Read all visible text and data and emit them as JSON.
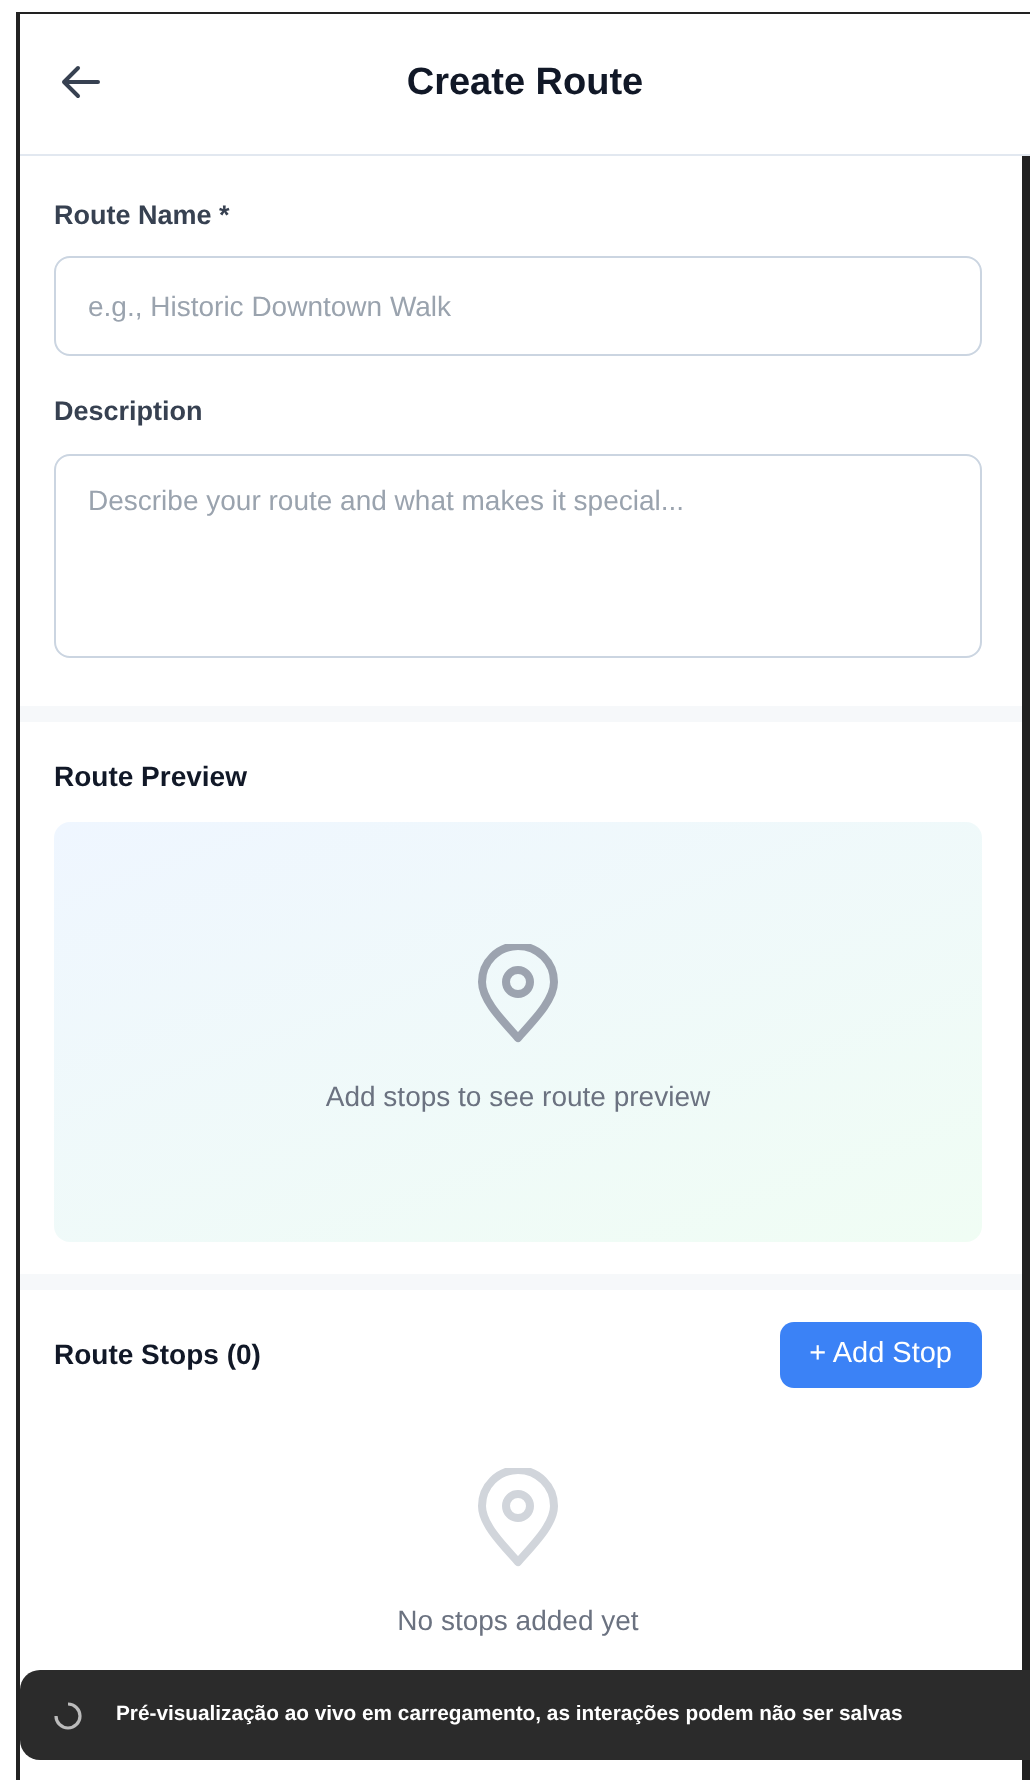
{
  "header": {
    "title": "Create Route"
  },
  "fields": [
    {
      "kind": "input",
      "label": "Route Name *",
      "placeholder": "e.g., Historic Downtown Walk"
    },
    {
      "kind": "textarea",
      "label": "Description",
      "placeholder": "Describe your route and what makes it special..."
    }
  ],
  "preview": {
    "title": "Route Preview",
    "empty_text": "Add stops to see route preview"
  },
  "stops": {
    "title": "Route Stops (0)",
    "add_button": "+ Add Stop",
    "empty_text": "No stops added yet"
  },
  "toast": {
    "text": "Pré-visualização ao vivo em carregamento, as interações podem não ser salvas"
  }
}
